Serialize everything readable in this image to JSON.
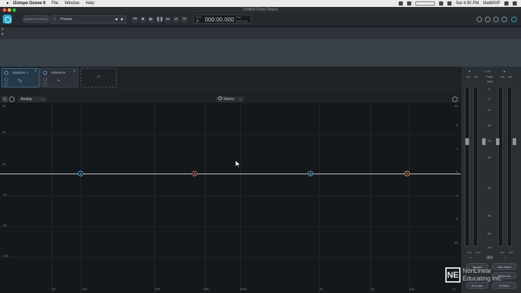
{
  "menubar": {
    "app": "iZotope Ozone 9",
    "items": [
      "File",
      "Window",
      "Help"
    ],
    "clock": "Sat 4:30 PM",
    "user": "MattMVP"
  },
  "window": {
    "title": "Untitled Ozone Project"
  },
  "toolbar": {
    "master_assistant_label": "Master Assistant",
    "presets_label": "Presets",
    "track_label": "Track",
    "track_number": "0",
    "time_label": "Time",
    "time_value": "000:00.000",
    "time_small": "000:00.000"
  },
  "timeline": {
    "add_label": "+",
    "remove_label": "×"
  },
  "modules": [
    {
      "name": "Equalizer 1",
      "glyph": "∿"
    },
    {
      "name": "Maximizer",
      "glyph": "◔"
    }
  ],
  "add_module_label": "+",
  "eq": {
    "mode": "Analog",
    "channel": "Stereo",
    "y_left": [
      "20",
      "30",
      "40",
      "0",
      "-40",
      "-80",
      "-100"
    ],
    "y_right": [
      "20",
      "8",
      "4",
      "0",
      "-4",
      "-8",
      "20"
    ],
    "x_labels": [
      "50",
      "100",
      "300",
      "600",
      "1000",
      "3k",
      "6k",
      "10k",
      "Hz"
    ],
    "nodes": [
      {
        "label": "1",
        "color": "#3fa0de"
      },
      {
        "label": "3",
        "color": "#e05a5a"
      },
      {
        "label": "5",
        "color": "#3fa0de"
      },
      {
        "label": "7",
        "color": "#e08a4a"
      }
    ]
  },
  "meters": {
    "left_vals": [
      "-inf",
      "-inf"
    ],
    "peak_label": "Peak",
    "rms_label": "RMS",
    "ratio_label": "I / O",
    "right_vals": [
      "-inf",
      "-inf"
    ],
    "scale": [
      "0",
      "-3",
      "-6",
      "-10",
      "-15",
      "-20",
      "-30",
      "-40",
      "-50",
      "-Inf"
    ],
    "bottom_left": [
      "0.0",
      "0.0"
    ],
    "bottom_right": [
      "0.0",
      "0.0"
    ],
    "link_label": "0.0"
  },
  "right_buttons": {
    "bypass": "Bypass",
    "gain_match": "Gain Match",
    "reference": "Reference",
    "codec": "Codec",
    "dither": "Dither"
  },
  "watermark": {
    "mark": "NE",
    "line1": "NonLinear",
    "line2": "Educating Inc."
  }
}
